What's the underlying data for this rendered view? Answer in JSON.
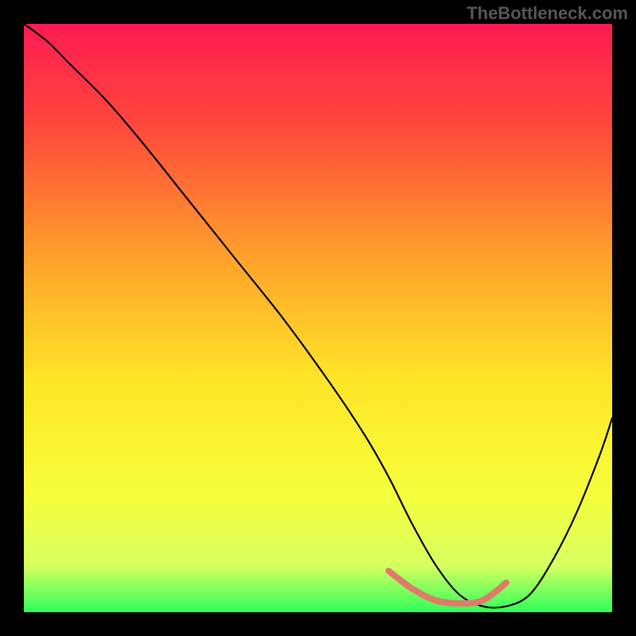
{
  "watermark": "TheBottleneck.com",
  "chart_data": {
    "type": "line",
    "title": "",
    "xlabel": "",
    "ylabel": "",
    "xlim": [
      0,
      100
    ],
    "ylim": [
      0,
      100
    ],
    "grid": false,
    "gradient_stops": [
      {
        "offset": 0,
        "color": "#ff1a52"
      },
      {
        "offset": 18,
        "color": "#ff4a3b"
      },
      {
        "offset": 40,
        "color": "#ffa22b"
      },
      {
        "offset": 60,
        "color": "#ffe427"
      },
      {
        "offset": 80,
        "color": "#f6ff3c"
      },
      {
        "offset": 92,
        "color": "#d8ff60"
      },
      {
        "offset": 100,
        "color": "#2fff5a"
      }
    ],
    "series": [
      {
        "name": "bottleneck-curve",
        "color": "#000000",
        "x": [
          0,
          4,
          8,
          14,
          20,
          28,
          36,
          44,
          52,
          58,
          62,
          66,
          70,
          74,
          78,
          82,
          86,
          90,
          94,
          98,
          100
        ],
        "y": [
          100,
          97,
          93,
          87,
          80,
          70,
          60,
          50,
          39,
          30,
          23,
          15,
          8,
          3,
          1,
          1,
          3,
          9,
          17,
          27,
          33
        ]
      }
    ],
    "highlight_segment": {
      "name": "sweet-spot",
      "color": "#e07a6a",
      "x": [
        62,
        66,
        70,
        74,
        78,
        82
      ],
      "y": [
        7,
        4,
        2,
        1.5,
        2,
        5
      ]
    }
  }
}
